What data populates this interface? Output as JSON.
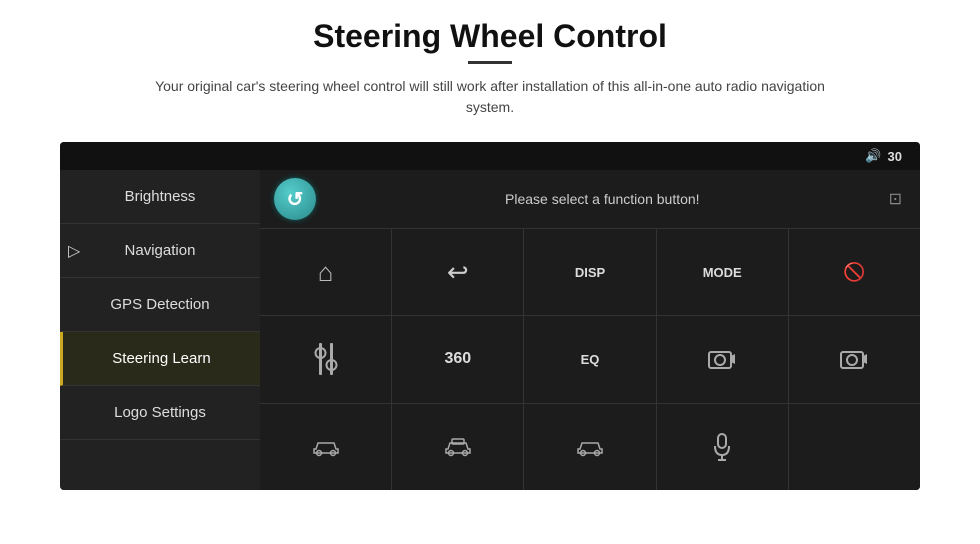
{
  "header": {
    "title": "Steering Wheel Control",
    "divider": true,
    "subtitle": "Your original car's steering wheel control will still work after installation of this all-in-one auto radio navigation system."
  },
  "screen": {
    "status_bar": {
      "volume_icon": "🔊",
      "volume_level": "30"
    },
    "sidebar": {
      "items": [
        {
          "id": "brightness",
          "label": "Brightness",
          "active": false
        },
        {
          "id": "navigation",
          "label": "Navigation",
          "active": false
        },
        {
          "id": "gps",
          "label": "GPS Detection",
          "active": false
        },
        {
          "id": "steering",
          "label": "Steering Learn",
          "active": true
        },
        {
          "id": "logo",
          "label": "Logo Settings",
          "active": false
        }
      ]
    },
    "content": {
      "prompt": "Please select a function button!",
      "refresh_symbol": "↺",
      "buttons": [
        {
          "id": "home",
          "type": "icon",
          "icon": "🏠",
          "label": ""
        },
        {
          "id": "back",
          "type": "icon",
          "icon": "↩",
          "label": ""
        },
        {
          "id": "disp",
          "type": "text",
          "label": "DISP"
        },
        {
          "id": "mode",
          "type": "text",
          "label": "MODE"
        },
        {
          "id": "phone-mute",
          "type": "icon",
          "icon": "📵",
          "label": ""
        },
        {
          "id": "tune",
          "type": "icon",
          "icon": "🎚",
          "label": ""
        },
        {
          "id": "360",
          "type": "text",
          "label": "360"
        },
        {
          "id": "eq",
          "type": "text",
          "label": "EQ"
        },
        {
          "id": "cam1",
          "type": "icon",
          "icon": "📷",
          "label": ""
        },
        {
          "id": "cam2",
          "type": "icon",
          "icon": "📷",
          "label": ""
        },
        {
          "id": "car1",
          "type": "icon",
          "icon": "🚗",
          "label": ""
        },
        {
          "id": "car2",
          "type": "icon",
          "icon": "🚙",
          "label": ""
        },
        {
          "id": "car3",
          "type": "icon",
          "icon": "🚗",
          "label": ""
        },
        {
          "id": "mic",
          "type": "icon",
          "icon": "🎤",
          "label": ""
        },
        {
          "id": "empty",
          "type": "empty",
          "label": ""
        }
      ]
    }
  }
}
